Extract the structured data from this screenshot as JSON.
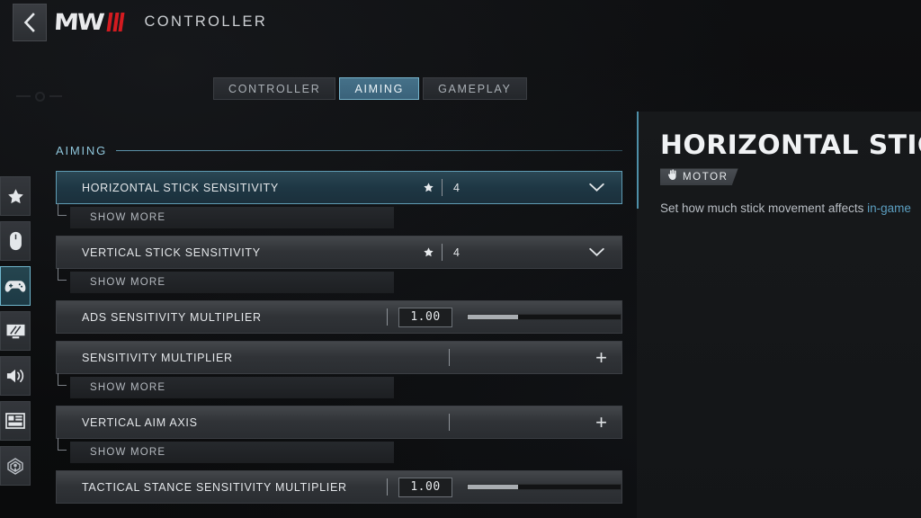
{
  "header": {
    "back_icon": "chevron-left-icon",
    "logo_text": "MW",
    "logo_bars": 3,
    "title": "CONTROLLER"
  },
  "sidebar": {
    "items": [
      {
        "icon": "star-icon",
        "name": "favorites",
        "active": false
      },
      {
        "icon": "mouse-icon",
        "name": "mouse-keyboard",
        "active": false
      },
      {
        "icon": "gamepad-icon",
        "name": "controller",
        "active": true
      },
      {
        "icon": "monitor-icon",
        "name": "graphics",
        "active": false
      },
      {
        "icon": "speaker-icon",
        "name": "audio",
        "active": false
      },
      {
        "icon": "interface-icon",
        "name": "interface",
        "active": false
      },
      {
        "icon": "account-icon",
        "name": "account-network",
        "active": false
      }
    ]
  },
  "tabs": [
    {
      "label": "CONTROLLER",
      "active": false
    },
    {
      "label": "AIMING",
      "active": true
    },
    {
      "label": "GAMEPLAY",
      "active": false
    }
  ],
  "section": {
    "label": "AIMING"
  },
  "rows": [
    {
      "name": "HORIZONTAL STICK SENSITIVITY",
      "type": "dropdown",
      "favorite": true,
      "value": "4",
      "selected": true,
      "show_more": "SHOW MORE"
    },
    {
      "name": "VERTICAL STICK SENSITIVITY",
      "type": "dropdown",
      "favorite": true,
      "value": "4",
      "selected": false,
      "show_more": "SHOW MORE"
    },
    {
      "name": "ADS SENSITIVITY MULTIPLIER",
      "type": "slider",
      "favorite": false,
      "value": "1.00",
      "fill_percent": 33,
      "selected": false,
      "show_more": null
    },
    {
      "name": "SENSITIVITY MULTIPLIER",
      "type": "expand",
      "favorite": false,
      "value": "",
      "selected": false,
      "show_more": "SHOW MORE"
    },
    {
      "name": "VERTICAL AIM AXIS",
      "type": "expand",
      "favorite": false,
      "value": "",
      "selected": false,
      "show_more": "SHOW MORE"
    },
    {
      "name": "TACTICAL STANCE SENSITIVITY MULTIPLIER",
      "type": "slider",
      "favorite": false,
      "value": "1.00",
      "fill_percent": 33,
      "selected": false,
      "show_more": null
    }
  ],
  "detail": {
    "title": "HORIZONTAL STICK",
    "badge_icon": "motor-hand-icon",
    "badge_label": "MOTOR",
    "description_before": "Set how much stick movement affects ",
    "description_highlight": "in-game"
  },
  "colors": {
    "accent_blue": "#5b9ec0",
    "tab_active_bg": "#3f6b83",
    "row_selected_border": "#5f9cb4",
    "logo_red": "#d31b20",
    "section_rule": "#5d93ab"
  }
}
